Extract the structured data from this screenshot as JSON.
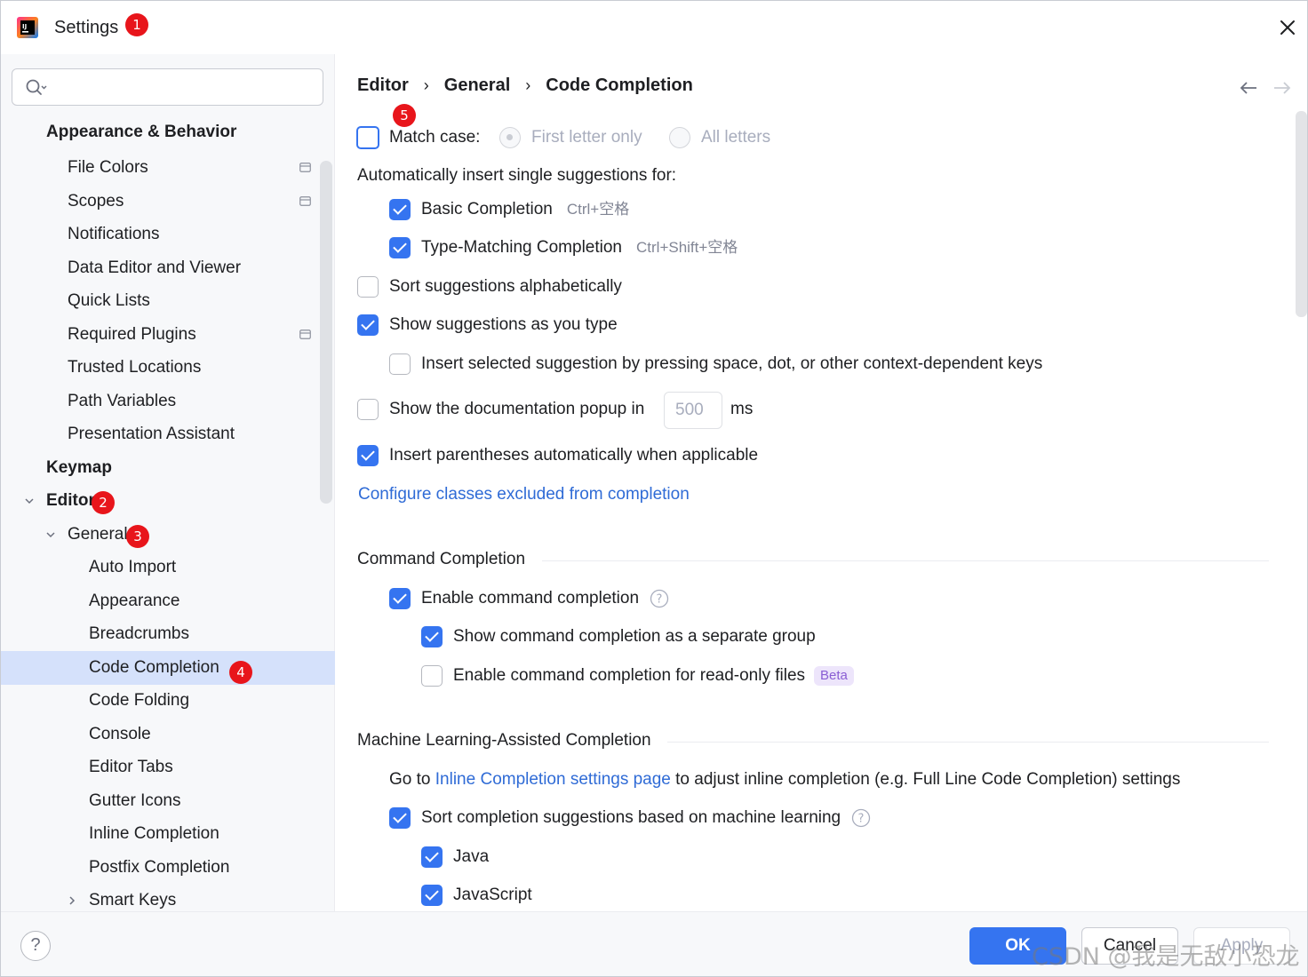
{
  "window": {
    "title": "Settings",
    "close_icon": "close-icon"
  },
  "markers": [
    "1",
    "2",
    "3",
    "4",
    "5"
  ],
  "search": {
    "placeholder": ""
  },
  "sidebar": {
    "items": [
      {
        "label": "Appearance & Behavior",
        "bold": true
      },
      {
        "label": "File Colors"
      },
      {
        "label": "Scopes"
      },
      {
        "label": "Notifications"
      },
      {
        "label": "Data Editor and Viewer"
      },
      {
        "label": "Quick Lists"
      },
      {
        "label": "Required Plugins"
      },
      {
        "label": "Trusted Locations"
      },
      {
        "label": "Path Variables"
      },
      {
        "label": "Presentation Assistant"
      },
      {
        "label": "Keymap",
        "bold": true
      },
      {
        "label": "Editor",
        "bold": true
      },
      {
        "label": "General"
      },
      {
        "label": "Auto Import"
      },
      {
        "label": "Appearance"
      },
      {
        "label": "Breadcrumbs"
      },
      {
        "label": "Code Completion",
        "selected": true
      },
      {
        "label": "Code Folding"
      },
      {
        "label": "Console"
      },
      {
        "label": "Editor Tabs"
      },
      {
        "label": "Gutter Icons"
      },
      {
        "label": "Inline Completion"
      },
      {
        "label": "Postfix Completion"
      },
      {
        "label": "Smart Keys"
      }
    ]
  },
  "breadcrumb": [
    "Editor",
    "General",
    "Code Completion"
  ],
  "options": {
    "match_case": {
      "label": "Match case:",
      "checked": false
    },
    "first_letter_only": "First letter only",
    "all_letters": "All letters",
    "auto_insert_heading": "Automatically insert single suggestions for:",
    "basic_completion": {
      "label": "Basic Completion",
      "shortcut": "Ctrl+空格",
      "checked": true
    },
    "type_matching": {
      "label": "Type-Matching Completion",
      "shortcut": "Ctrl+Shift+空格",
      "checked": true
    },
    "sort_alpha": {
      "label": "Sort suggestions alphabetically",
      "checked": false
    },
    "show_as_type": {
      "label": "Show suggestions as you type",
      "checked": true
    },
    "insert_selected": {
      "label": "Insert selected suggestion by pressing space, dot, or other context-dependent keys",
      "checked": false
    },
    "doc_popup": {
      "label": "Show the documentation popup in",
      "value": "500",
      "unit": "ms",
      "checked": false
    },
    "insert_parens": {
      "label": "Insert parentheses automatically when applicable",
      "checked": true
    },
    "configure_link": "Configure classes excluded from completion"
  },
  "command_completion": {
    "heading": "Command Completion",
    "enable": {
      "label": "Enable command completion",
      "checked": true
    },
    "separate_group": {
      "label": "Show command completion as a separate group",
      "checked": true
    },
    "read_only": {
      "label": "Enable command completion for read-only files",
      "badge": "Beta",
      "checked": false
    }
  },
  "ml_completion": {
    "heading": "Machine Learning-Assisted Completion",
    "go_to": "Go to",
    "link": "Inline Completion settings page",
    "rest": "to adjust inline completion (e.g. Full Line Code Completion) settings",
    "sort_ml": {
      "label": "Sort completion suggestions based on machine learning",
      "checked": true
    },
    "java": {
      "label": "Java",
      "checked": true
    },
    "javascript": {
      "label": "JavaScript",
      "checked": true
    }
  },
  "footer": {
    "ok": "OK",
    "cancel": "Cancel",
    "apply": "Apply",
    "help": "?"
  },
  "watermark": "CSDN @我是无敌小恐龙",
  "colors": {
    "accent": "#3574f0",
    "selected_row": "#d5e1fb",
    "marker": "#e8151b",
    "link": "#2f6bd6"
  }
}
